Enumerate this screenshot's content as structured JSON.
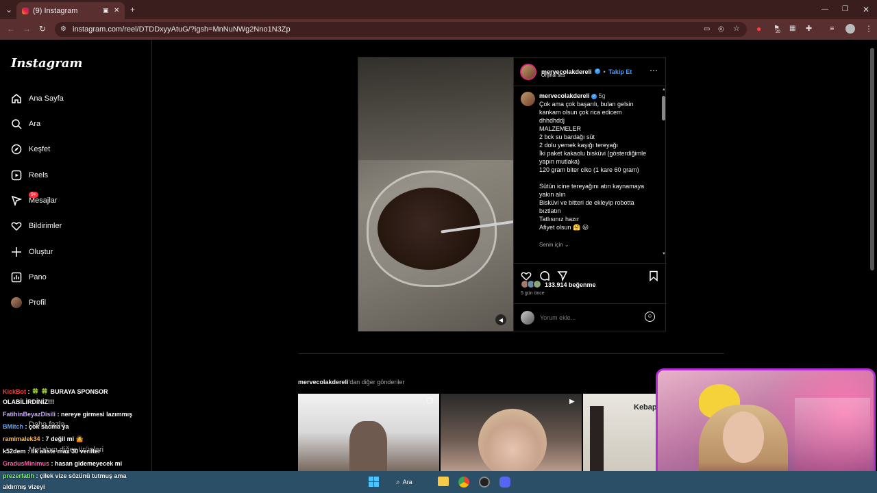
{
  "browser": {
    "tab_title": "(9) Instagram",
    "url": "instagram.com/reel/DTDDxyyAtuG/?igsh=MnNuNWg2Nno1N3Zp",
    "extension_badge": "20"
  },
  "sidebar": {
    "logo": "Instagram",
    "items": [
      {
        "label": "Ana Sayfa",
        "icon": "home-icon"
      },
      {
        "label": "Ara",
        "icon": "search-icon"
      },
      {
        "label": "Keşfet",
        "icon": "compass-icon"
      },
      {
        "label": "Reels",
        "icon": "reels-icon"
      },
      {
        "label": "Mesajlar",
        "icon": "messenger-icon",
        "badge": "9+"
      },
      {
        "label": "Bildirimler",
        "icon": "heart-icon"
      },
      {
        "label": "Oluştur",
        "icon": "plus-icon"
      },
      {
        "label": "Pano",
        "icon": "chart-icon"
      },
      {
        "label": "Profil",
        "icon": "avatar-icon"
      }
    ],
    "more_label": "Daha fazla",
    "also_from_meta": "Meta'nın diğer ürünleri"
  },
  "post": {
    "username": "mervecolakdereli",
    "follow_label": "Takip Et",
    "audio_label": "Orijinal ses",
    "time_ago": "5g",
    "caption_lines": [
      "Çok ama çok başarılı, bulan gelsin",
      "kankam olsun çok rica edicem",
      "dhhdhddj",
      "MALZEMELER",
      "2 bck su bardağı süt",
      "2 dolu yemek kaşığı tereyağı",
      "İki paket kakaolu bisküvi (gösterdiğimle",
      "yapın mutlaka)",
      "120 gram biter ciko (1 kare 60 gram)",
      "",
      "Sütün icine tereyağını atın kaynamaya",
      "yakın alın",
      "Bisküvi ve bitteri de ekleyip robotta",
      "bıztlatın",
      "Tatlısınız hazır",
      "Afiyet olsun 🤗 😛"
    ],
    "for_you_label": "Senin için",
    "likes": "133.914 beğenme",
    "posted": "5 gün önce",
    "comment_placeholder": "Yorum ekle..."
  },
  "more_posts": {
    "owner": "mervecolakdereli",
    "suffix": "'dan diğer gönderiler",
    "third_thumb_text": "Kebap"
  },
  "chat": [
    {
      "user": "KickBot",
      "color": "#ff3b3b",
      "text": ": 🍀 🍀 BURAYA SPONSOR"
    },
    {
      "user": "",
      "color": "#ffffff",
      "text": "OLABİLİRDİNİZ!!!"
    },
    {
      "user": "FatihinBeyazDisili",
      "color": "#c9a8ff",
      "text": ": nereye girmesi lazımmış"
    },
    {
      "user": "BMitch",
      "color": "#5da3ff",
      "text": ": çok sacma ya"
    },
    {
      "user": "ramimalek34",
      "color": "#ffb84d",
      "text": ": 7 değil mi 🤷"
    },
    {
      "user": "k52dem",
      "color": "#ffffff",
      "text": ": ilk aliste max 30 verilter"
    },
    {
      "user": "GradusMinimus",
      "color": "#ff5ca8",
      "text": ": hasan gidemeyecek mi"
    },
    {
      "user": "prezerfatih",
      "color": "#7dff6a",
      "text": ": çilek vize sözünü tutmuş ama"
    },
    {
      "user": "",
      "color": "#ffffff",
      "text": "aldırmış vizeyi"
    }
  ],
  "taskbar": {
    "search_label": "Ara"
  }
}
